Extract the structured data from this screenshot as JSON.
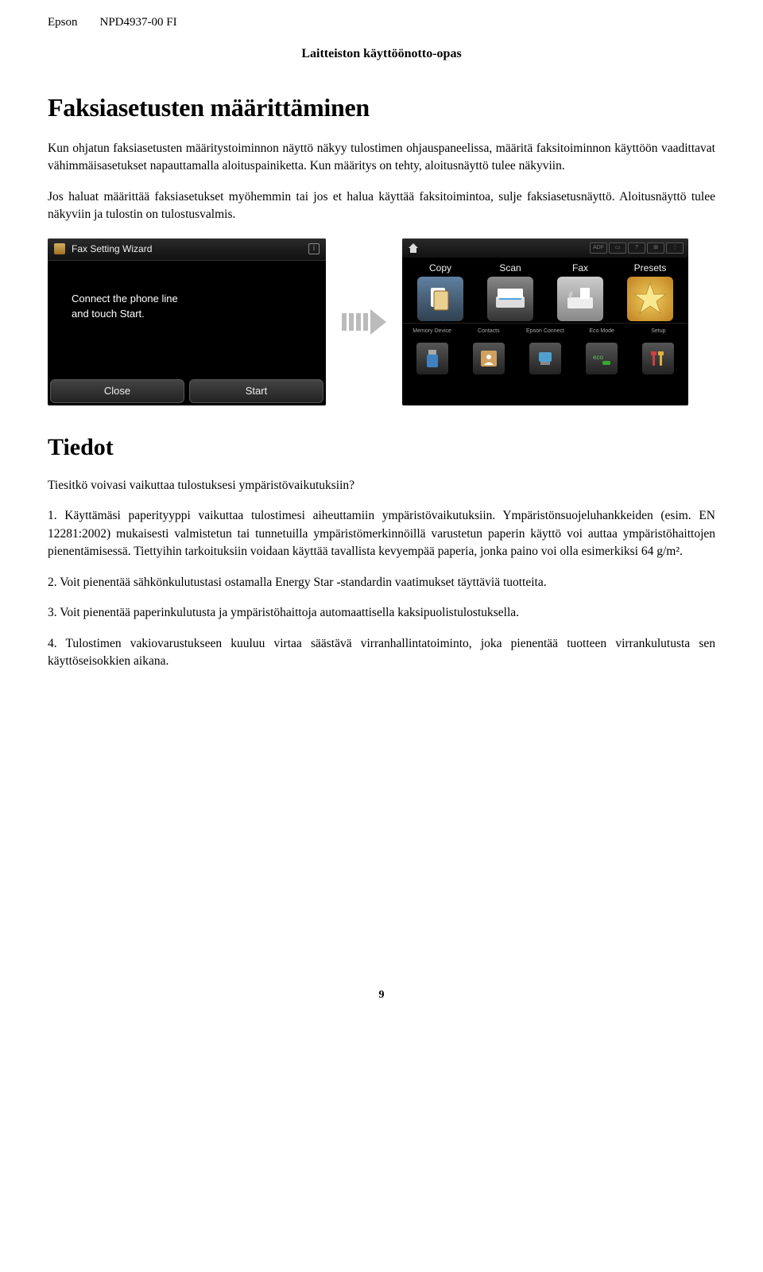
{
  "header": {
    "brand": "Epson",
    "docref": "NPD4937-00 FI"
  },
  "doc_title": "Laitteiston käyttöönotto-opas",
  "h1": "Faksiasetusten määrittäminen",
  "p1": "Kun ohjatun faksiasetusten määritystoiminnon näyttö näkyy tulostimen ohjauspaneelissa, määritä faksitoiminnon käyttöön vaadittavat vähimmäisasetukset napauttamalla aloituspainiketta. Kun määritys on tehty, aloitusnäyttö tulee näkyviin.",
  "p2": "Jos haluat määrittää faksiasetukset myöhemmin tai jos et halua käyttää faksitoimintoa, sulje faksiasetusnäyttö. Aloitusnäyttö tulee näkyviin ja tulostin on tulostusvalmis.",
  "wizard": {
    "title": "Fax Setting Wizard",
    "body_line1": "Connect the phone line",
    "body_line2": "and touch Start.",
    "close": "Close",
    "start": "Start"
  },
  "home": {
    "status_adf": "ADF",
    "main": [
      {
        "label": "Copy"
      },
      {
        "label": "Scan"
      },
      {
        "label": "Fax"
      },
      {
        "label": "Presets"
      }
    ],
    "sub": [
      {
        "label": "Memory Device"
      },
      {
        "label": "Contacts"
      },
      {
        "label": "Epson Connect"
      },
      {
        "label": "Eco Mode"
      },
      {
        "label": "Setup"
      }
    ]
  },
  "h2": "Tiedot",
  "q": "Tiesitkö voivasi vaikuttaa tulostuksesi ympäristövaikutuksiin?",
  "t1": "1. Käyttämäsi paperityyppi vaikuttaa tulostimesi aiheuttamiin ympäristövaikutuksiin. Ympäristönsuojeluhankkeiden (esim. EN 12281:2002) mukaisesti valmistetun tai tunnetuilla ympäristömerkinnöillä varustetun paperin käyttö voi auttaa ympäristöhaittojen pienentämisessä. Tiettyihin tarkoituksiin voidaan käyttää tavallista kevyempää paperia, jonka paino voi olla esimerkiksi 64 g/m².",
  "t2": "2. Voit pienentää sähkönkulutustasi ostamalla Energy Star -standardin vaatimukset täyttäviä tuotteita.",
  "t3": "3. Voit pienentää paperinkulutusta ja ympäristöhaittoja automaattisella kaksipuolistulostuksella.",
  "t4": "4. Tulostimen vakiovarustukseen kuuluu virtaa säästävä virranhallintatoiminto, joka pienentää tuotteen virrankulutusta sen käyttöseisokkien aikana.",
  "page": "9"
}
